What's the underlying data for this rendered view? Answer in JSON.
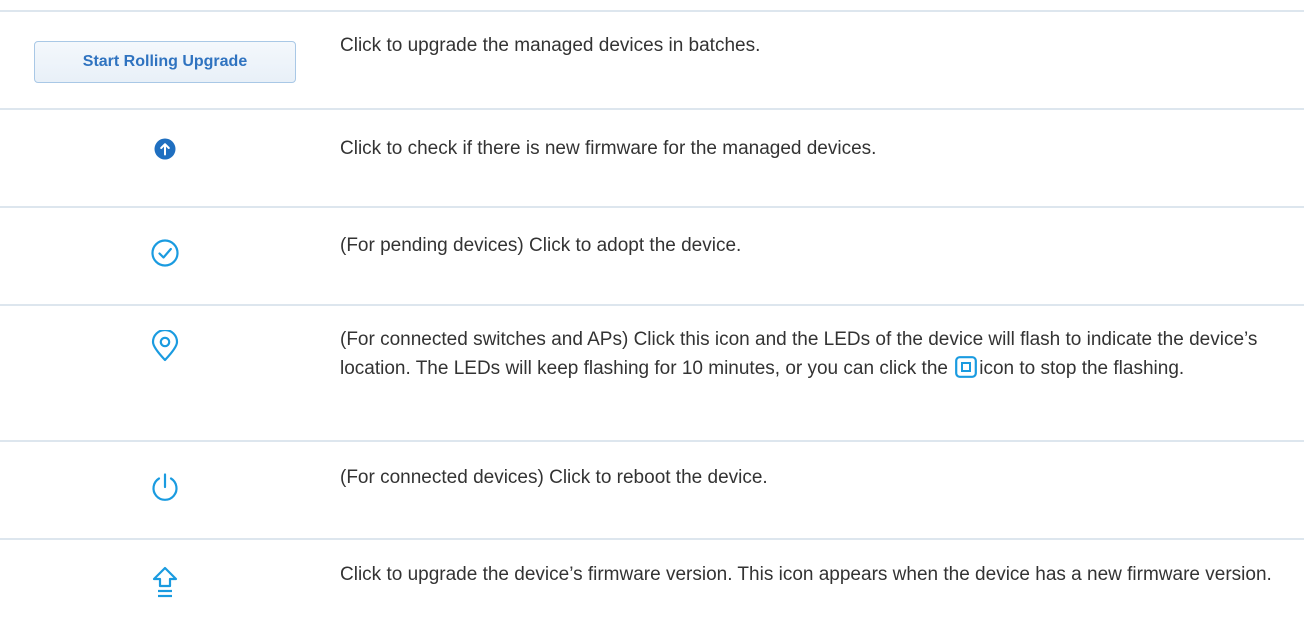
{
  "colors": {
    "accent": "#1a9be0",
    "deep_blue": "#1f6fc0",
    "button_text": "#2f73c0",
    "rule": "#dde6ee",
    "text": "#333333"
  },
  "rows": [
    {
      "icon": "start-rolling-upgrade-button",
      "button_label": "Start Rolling Upgrade",
      "description": "Click to upgrade the managed devices in batches."
    },
    {
      "icon": "upgrade-check-icon",
      "description": "Click to check if there is new firmware for the managed devices."
    },
    {
      "icon": "adopt-check-icon",
      "description": "(For pending devices) Click to adopt the device."
    },
    {
      "icon": "locate-icon",
      "description_before": "(For connected switches and APs) Click this icon and the LEDs of the device will flash to indicate the device’s location. The LEDs will keep flashing for 10 minutes, or you can click the",
      "inline_icon": "stop-icon",
      "description_after": "icon to stop the flashing."
    },
    {
      "icon": "reboot-icon",
      "description": "(For connected devices) Click to reboot the device."
    },
    {
      "icon": "firmware-upgrade-icon",
      "description": "Click to upgrade the device’s firmware version. This icon appears when the device has a new firmware version."
    }
  ]
}
